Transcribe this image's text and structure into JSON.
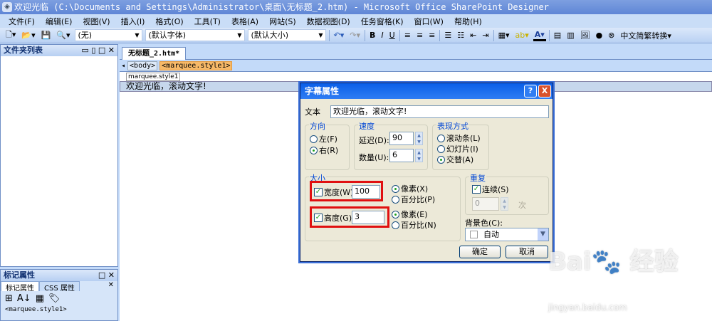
{
  "window": {
    "title": "欢迎光临  (C:\\Documents and Settings\\Administrator\\桌面\\无标题_2.htm) - Microsoft Office SharePoint Designer",
    "icon": "app-icon"
  },
  "menu": [
    "文件(F)",
    "编辑(E)",
    "视图(V)",
    "插入(I)",
    "格式(O)",
    "工具(T)",
    "表格(A)",
    "网站(S)",
    "数据视图(D)",
    "任务窗格(K)",
    "窗口(W)",
    "帮助(H)"
  ],
  "toolbar": {
    "style": "(无)",
    "font": "(默认字体)",
    "size": "(默认大小)",
    "bold": "B",
    "italic": "I",
    "underline": "U",
    "font_color": "A",
    "convert": "中文简繁转换"
  },
  "folder_panel": {
    "title": "文件夹列表"
  },
  "tag_panel": {
    "title": "标记属性",
    "tabs": [
      "标记属性",
      "CSS 属性"
    ],
    "tag": "<marquee.style1>"
  },
  "editor": {
    "tab": "无标题_2.htm*",
    "crumbs": [
      "<body>",
      "<marquee.style1>"
    ],
    "tag_label": "marquee.style1",
    "content": "欢迎光临，滚动文字!"
  },
  "dialog": {
    "title": "字幕属性",
    "help": "?",
    "close": "X",
    "text_label": "文本",
    "text_value": "欢迎光临，滚动文字!",
    "direction": {
      "label": "方向",
      "left": "左(F)",
      "right": "右(R)",
      "selected": "right"
    },
    "speed": {
      "label": "速度",
      "delay_label": "延迟(D):",
      "delay": "90",
      "amount_label": "数量(U):",
      "amount": "6"
    },
    "behavior": {
      "label": "表现方式",
      "scroll": "滚动条(L)",
      "slide": "幻灯片(I)",
      "alternate": "交替(A)",
      "selected": "alternate"
    },
    "size": {
      "label": "大小",
      "width_label": "宽度(W):",
      "width": "100",
      "width_checked": true,
      "px1": "像素(X)",
      "pct1": "百分比(P)",
      "height_label": "高度(G):",
      "height": "3",
      "height_checked": true,
      "px2": "像素(E)",
      "pct2": "百分比(N)"
    },
    "repeat": {
      "label": "重复",
      "continuous": "连续(S)",
      "count": "0",
      "times": "次"
    },
    "bgcolor": {
      "label": "背景色(C):",
      "value": "自动"
    },
    "ok": "确定",
    "cancel": "取消"
  },
  "watermark": {
    "logo": "Bai du 经验",
    "url": "jingyan.baidu.com"
  },
  "colors": {
    "highlight": "#e01010",
    "title": "#0a5fe8"
  }
}
